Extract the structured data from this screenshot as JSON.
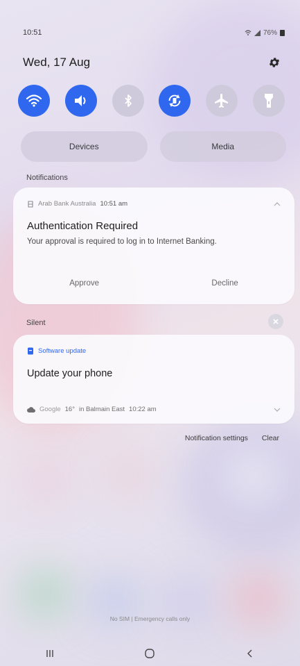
{
  "status_bar": {
    "time": "10:51",
    "battery": "76%"
  },
  "header": {
    "date": "Wed, 17 Aug"
  },
  "quick_toggles": [
    {
      "name": "wifi-toggle",
      "icon": "wifi-icon",
      "state": "on"
    },
    {
      "name": "sound-toggle",
      "icon": "speaker-icon",
      "state": "on"
    },
    {
      "name": "bluetooth-toggle",
      "icon": "bluetooth-icon",
      "state": "off"
    },
    {
      "name": "auto-rotate-toggle",
      "icon": "rotate-icon",
      "state": "on"
    },
    {
      "name": "airplane-toggle",
      "icon": "airplane-icon",
      "state": "off"
    },
    {
      "name": "flashlight-toggle",
      "icon": "flashlight-icon",
      "state": "off"
    }
  ],
  "pills": {
    "devices": "Devices",
    "media": "Media"
  },
  "notifications": {
    "section_label": "Notifications",
    "bank": {
      "app": "Arab Bank Australia",
      "time": "10:51 am",
      "title": "Authentication Required",
      "body": "Your approval is required to log in to Internet Banking.",
      "approve": "Approve",
      "decline": "Decline"
    }
  },
  "silent": {
    "section_label": "Silent",
    "software": {
      "app": "Software update",
      "title": "Update your phone"
    },
    "weather": {
      "source": "Google",
      "temp": "16°",
      "location": "in Balmain East",
      "time": "10:22 am"
    }
  },
  "footer": {
    "notification_settings": "Notification settings",
    "clear": "Clear",
    "emergency": "No SIM | Emergency calls only"
  },
  "colors": {
    "accent": "#2f67ee",
    "toggle_off": "#cfcadb"
  }
}
